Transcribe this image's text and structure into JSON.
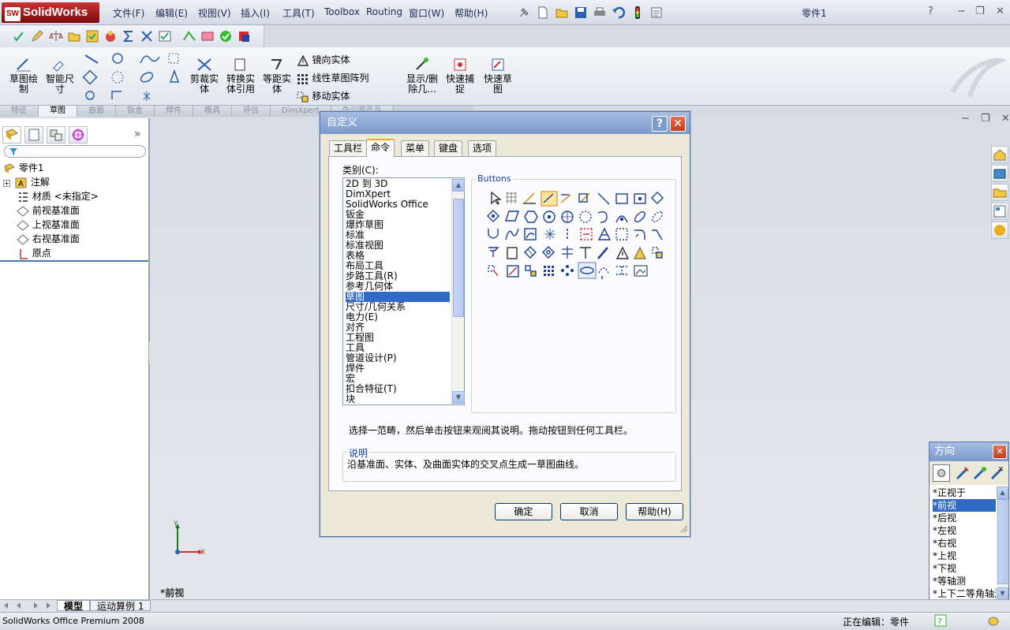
{
  "app": {
    "title": "SolidWorks",
    "document": "零件1"
  },
  "menu": [
    "文件(F)",
    "编辑(E)",
    "视图(V)",
    "插入(I)",
    "工具(T)",
    "Toolbox",
    "Routing",
    "窗口(W)",
    "帮助(H)"
  ],
  "window_controls": {
    "help": "?",
    "minimize": "−",
    "restore": "❐",
    "close": "✕"
  },
  "ribbon": {
    "sketch": "草图绘\n制",
    "smart_dim": "智能尺\n寸",
    "trim": "剪裁实\n体",
    "convert": "转换实\n体引用",
    "offset": "等距实\n体",
    "mirror": "镜向实体",
    "linear_pattern": "线性草图阵列",
    "move": "移动实体",
    "show_delete": "显示/删\n除几...",
    "quick_snap": "快速捕\n捉",
    "rapid_sketch": "快速草\n图"
  },
  "command_tabs": [
    "特征",
    "草图",
    "曲面",
    "钣金",
    "焊件",
    "模具",
    "评估",
    "DimXpert",
    "办公室产品"
  ],
  "active_command_tab": "草图",
  "feature_tree": {
    "expand_more": "»",
    "root": "零件1",
    "items": [
      "注解",
      "材质 <未指定>",
      "前视基准面",
      "上视基准面",
      "右视基准面",
      "原点"
    ]
  },
  "viewport": {
    "view_label": "*前视",
    "axis_y": "Y",
    "axis_x": "X"
  },
  "bottom_tabs": [
    "模型",
    "运动算例 1"
  ],
  "status": {
    "product": "SolidWorks Office Premium 2008",
    "editing": "正在编辑：零件"
  },
  "dialog": {
    "title": "自定义",
    "help_glyph": "?",
    "close_glyph": "✕",
    "tabs": [
      "工具栏",
      "命令",
      "菜单",
      "键盘",
      "选项"
    ],
    "active_tab": "命令",
    "category_label": "类别(C):",
    "categories": [
      "2D 到 3D",
      "DimXpert",
      "SolidWorks Office",
      "钣金",
      "爆炸草图",
      "标准",
      "标准视图",
      "表格",
      "布局工具",
      "步路工具(R)",
      "参考几何体",
      "草图",
      "尺寸/几何关系",
      "电力(E)",
      "对齐",
      "工程图",
      "工具",
      "管道设计(P)",
      "焊件",
      "宏",
      "扣合特征(T)",
      "块"
    ],
    "selected_category": "草图",
    "buttons_label": "Buttons",
    "hint": "选择一范畴，然后单击按钮来观阅其说明。拖动按钮到任何工具栏。",
    "description_label": "说明",
    "description": "沿基准面、实体、及曲面实体的交叉点生成一草图曲线。",
    "ok": "确定",
    "cancel": "取消",
    "help": "帮助(H)"
  },
  "direction_panel": {
    "title": "方向",
    "close_glyph": "✕",
    "items": [
      "*正视于",
      "*前视",
      "*后视",
      "*左视",
      "*右视",
      "*上视",
      "*下视",
      "*等轴测",
      "*上下二等角轴测"
    ],
    "selected": "*前视"
  },
  "colors": {
    "selection": "#316ac5",
    "title_bar": "#7b99cc",
    "accent_tab": "#f6a81e"
  }
}
